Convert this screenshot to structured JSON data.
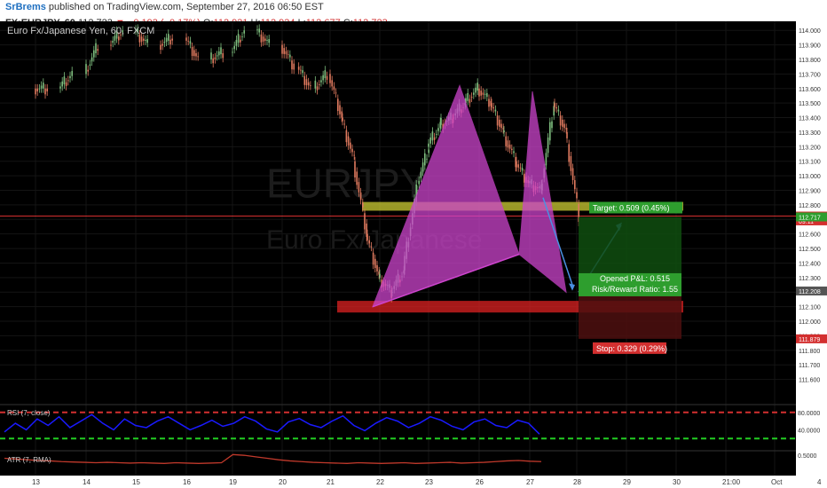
{
  "header": {
    "author": "SrBrems",
    "published_text": "published on TradingView.com, September 27, 2016 06:50 EST"
  },
  "ohlc": {
    "symbol": "FX:EURJPY, 60",
    "last": "112.723",
    "change": "▼ −0.193 (−0.17%)",
    "open_label": "O:",
    "open": "112.931",
    "high_label": "H:",
    "high": "112.934",
    "low_label": "L:",
    "low": "112.677",
    "close_label": "C:",
    "close": "112.723"
  },
  "chart_data": {
    "type": "line",
    "title": "Euro Fx/Japanese Yen, 60, FXCM",
    "watermark": [
      "EURJPY",
      "Euro Fx/Japanese"
    ],
    "colors": {
      "background": "#000000",
      "up": "#7fbf7f",
      "down": "#e07a5f",
      "pattern": "#cc44cc",
      "rsi": "#1a1aff",
      "atr": "#c0392b"
    },
    "ylim": [
      111.5,
      114.05
    ],
    "y_ticks": [
      "114.000",
      "113.900",
      "113.800",
      "113.700",
      "113.600",
      "113.500",
      "113.400",
      "113.300",
      "113.200",
      "113.100",
      "113.000",
      "112.900",
      "112.800",
      "112.700",
      "112.600",
      "112.500",
      "112.400",
      "112.300",
      "112.200",
      "112.100",
      "112.000",
      "111.900",
      "111.800",
      "111.700",
      "111.600"
    ],
    "x_ticks": [
      "13",
      "14",
      "15",
      "16",
      "19",
      "20",
      "21",
      "22",
      "23",
      "26",
      "27",
      "28",
      "29",
      "30",
      "21:00",
      "Oct",
      "4"
    ],
    "price_labels": [
      {
        "value": 112.723,
        "text": "112.723",
        "color": "#d32f2f"
      },
      {
        "value": 112.69,
        "text": "09:11",
        "color": "#d32f2f"
      },
      {
        "value": 112.717,
        "text": "112.717",
        "color": "#2e9e2e"
      },
      {
        "value": 112.208,
        "text": "112.208",
        "color": "#555555"
      },
      {
        "value": 111.879,
        "text": "111.879",
        "color": "#d32f2f"
      }
    ],
    "series": [
      {
        "name": "Close",
        "points": [
          [
            "13",
            113.6
          ],
          [
            "13",
            113.7
          ],
          [
            "14",
            113.9
          ],
          [
            "14",
            114.0
          ],
          [
            "15",
            113.9
          ],
          [
            "15",
            113.95
          ],
          [
            "16",
            113.8
          ],
          [
            "16",
            113.85
          ],
          [
            "19",
            114.0
          ],
          [
            "19",
            113.9
          ],
          [
            "20",
            113.75
          ],
          [
            "20",
            113.6
          ],
          [
            "20",
            113.7
          ],
          [
            "21",
            113.4
          ],
          [
            "21",
            113.1
          ],
          [
            "21",
            112.6
          ],
          [
            "21",
            112.3
          ],
          [
            "22",
            112.2
          ],
          [
            "22",
            112.35
          ],
          [
            "22",
            112.9
          ],
          [
            "22",
            113.2
          ],
          [
            "23",
            113.35
          ],
          [
            "23",
            113.4
          ],
          [
            "23",
            113.5
          ],
          [
            "23",
            113.6
          ],
          [
            "26",
            113.5
          ],
          [
            "26",
            113.3
          ],
          [
            "26",
            113.1
          ],
          [
            "26",
            112.95
          ],
          [
            "27",
            112.9
          ],
          [
            "27",
            113.5
          ],
          [
            "27",
            113.3
          ],
          [
            "27",
            112.723
          ]
        ]
      }
    ],
    "pattern": {
      "name": "Bearish Cypher (harmonic)",
      "points": [
        [
          "22",
          112.1
        ],
        [
          "23",
          113.62
        ],
        [
          "26",
          112.46
        ],
        [
          "27",
          113.58
        ],
        [
          "28",
          112.2
        ]
      ]
    },
    "zones": [
      {
        "name": "resistance",
        "range": [
          112.76,
          112.82
        ],
        "color": "#cccc33"
      },
      {
        "name": "support",
        "range": [
          112.06,
          112.14
        ],
        "color": "#dd2222"
      }
    ],
    "position": {
      "entry": 112.208,
      "target": 112.717,
      "stop": 111.879,
      "target_label": "Target: 0.509 (0.45%)",
      "pl_label": "Opened P&L: 0.515",
      "rr_label": "Risk/Reward Ratio: 1.55",
      "stop_label": "Stop: 0.329 (0.29%)"
    },
    "rsi": {
      "label": "RSI (7, close)",
      "ticks": [
        "80.0000",
        "40.0000"
      ],
      "overbought": 80,
      "oversold": 20,
      "values": [
        35,
        55,
        40,
        65,
        50,
        70,
        45,
        60,
        75,
        55,
        40,
        65,
        50,
        45,
        60,
        70,
        55,
        40,
        50,
        62,
        48,
        55,
        70,
        60,
        42,
        35,
        58,
        66,
        52,
        45,
        60,
        72,
        50,
        38,
        55,
        68,
        60,
        45,
        55,
        70,
        62,
        48,
        40,
        58,
        65,
        50,
        45,
        62,
        55,
        30
      ]
    },
    "atr": {
      "label": "ATR (7, RMA)",
      "tick": "0.5000",
      "values": [
        0.42,
        0.4,
        0.38,
        0.36,
        0.35,
        0.33,
        0.32,
        0.31,
        0.3,
        0.31,
        0.3,
        0.29,
        0.3,
        0.29,
        0.28,
        0.3,
        0.29,
        0.28,
        0.29,
        0.3,
        0.52,
        0.5,
        0.46,
        0.42,
        0.38,
        0.35,
        0.33,
        0.31,
        0.3,
        0.29,
        0.28,
        0.3,
        0.29,
        0.28,
        0.29,
        0.3,
        0.28,
        0.29,
        0.3,
        0.31,
        0.29,
        0.3,
        0.31,
        0.33,
        0.35,
        0.36,
        0.34,
        0.33
      ]
    }
  }
}
